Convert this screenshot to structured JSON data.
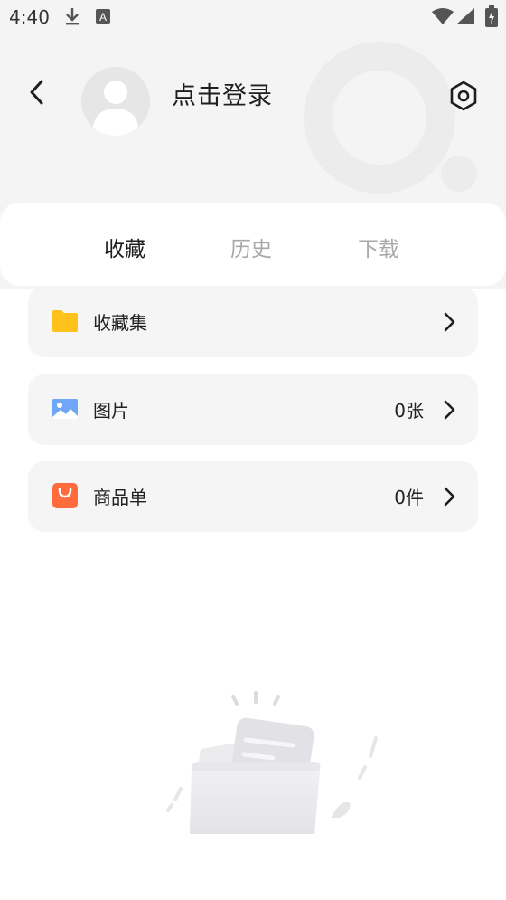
{
  "status": {
    "time": "4:40"
  },
  "header": {
    "login_text": "点击登录"
  },
  "tabs": [
    {
      "label": "收藏"
    },
    {
      "label": "历史"
    },
    {
      "label": "下载"
    }
  ],
  "rows": [
    {
      "label": "收藏集",
      "count": "",
      "icon": "folder-icon"
    },
    {
      "label": "图片",
      "count": "0张",
      "icon": "image-icon"
    },
    {
      "label": "商品单",
      "count": "0件",
      "icon": "shopping-bag-icon"
    }
  ],
  "colors": {
    "folder": "#FFC21A",
    "image": "#6FA6F7",
    "bag": "#FF6B3D",
    "tab_active": "#1E1E1E",
    "tab_inactive": "#A8A8A8"
  }
}
